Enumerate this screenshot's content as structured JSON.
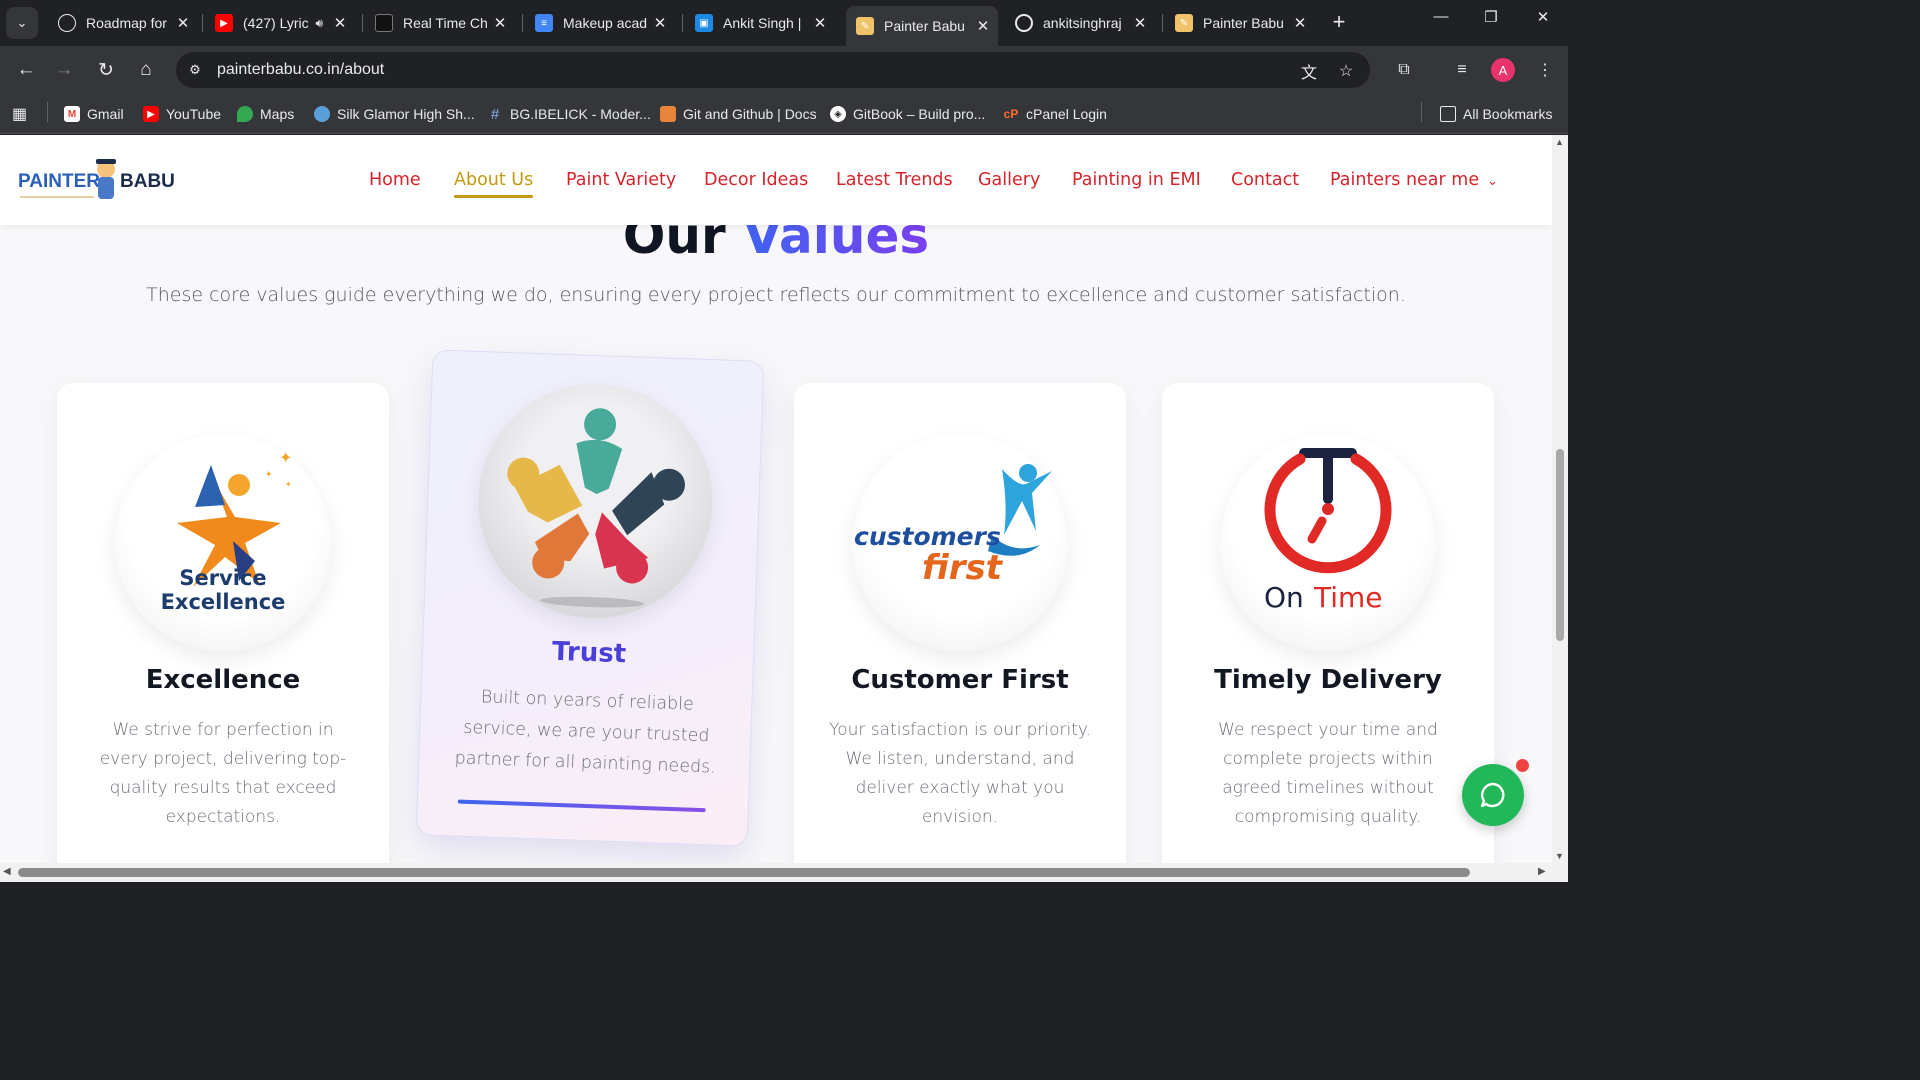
{
  "browser": {
    "tabs": [
      {
        "title": "Roadmap for",
        "favicon": "chatgpt-icon",
        "active": false
      },
      {
        "title": "(427) Lyric",
        "favicon": "youtube-icon",
        "active": false
      },
      {
        "title": "Real Time Ch",
        "favicon": "app-icon",
        "active": false
      },
      {
        "title": "Makeup acad",
        "favicon": "docs-icon",
        "active": false
      },
      {
        "title": "Ankit Singh |",
        "favicon": "briefcase-icon",
        "active": false
      },
      {
        "title": "Painter Babu",
        "favicon": "painter-icon",
        "active": true
      },
      {
        "title": "ankitsinghraj",
        "favicon": "github-icon",
        "active": false
      },
      {
        "title": "Painter Babu",
        "favicon": "painter-icon",
        "active": false
      }
    ],
    "url": "painterbabu.co.in/about",
    "profile_initial": "A",
    "bookmarks": [
      {
        "label": "Gmail",
        "icon": "gmail-icon"
      },
      {
        "label": "YouTube",
        "icon": "youtube-icon"
      },
      {
        "label": "Maps",
        "icon": "maps-icon"
      },
      {
        "label": "Silk Glamor High Sh...",
        "icon": "tooth-icon"
      },
      {
        "label": "BG.IBELICK - Moder...",
        "icon": "hash-icon"
      },
      {
        "label": "Git and Github | Docs",
        "icon": "docs-icon"
      },
      {
        "label": "GitBook – Build pro...",
        "icon": "gitbook-icon"
      },
      {
        "label": "cPanel Login",
        "icon": "cpanel-icon"
      }
    ],
    "all_bookmarks": "All Bookmarks"
  },
  "site": {
    "logo_text": "PAINTER BABU",
    "nav": [
      "Home",
      "About Us",
      "Paint Variety",
      "Decor Ideas",
      "Latest Trends",
      "Gallery",
      "Painting in EMI",
      "Contact",
      "Painters near me"
    ],
    "active_nav": "About Us"
  },
  "values": {
    "title_part1": "Our",
    "title_part2": "Values",
    "subtitle": "These core values guide everything we do, ensuring every project reflects our commitment to excellence and customer satisfaction.",
    "cards": [
      {
        "title": "Excellence",
        "desc": "We strive for perfection in every project, delivering top-quality results that exceed expectations.",
        "badge_line1": "Service",
        "badge_line2": "Excellence"
      },
      {
        "title": "Trust",
        "desc": "Built on years of reliable service, we are your trusted partner for all painting needs."
      },
      {
        "title": "Customer First",
        "desc": "Your satisfaction is our priority. We listen, understand, and deliver exactly what you envision.",
        "badge_line1": "customers",
        "badge_line2": "first"
      },
      {
        "title": "Timely Delivery",
        "desc": "We respect your time and complete projects within agreed timelines without compromising quality.",
        "badge_line1": "On",
        "badge_line2": "Time"
      }
    ]
  },
  "colors": {
    "nav_red": "#d8232a",
    "nav_active": "#c49a10",
    "accent_blue": "#3f63f0",
    "accent_purple": "#7b3ff0",
    "chat_green": "#22b85a"
  }
}
